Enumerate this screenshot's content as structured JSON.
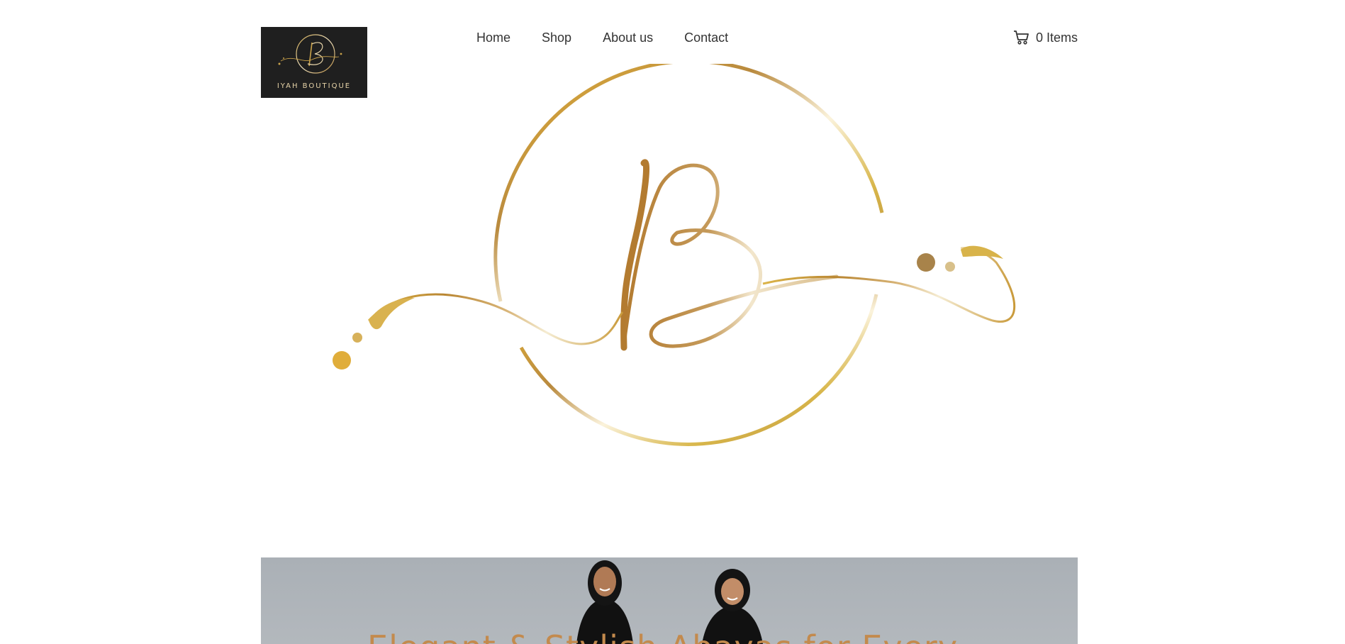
{
  "header": {
    "logo": {
      "brand_text": "IYAH BOUTIQUE",
      "background": "#1f1f1f",
      "icon": "iyah-monogram-logo"
    },
    "nav": [
      {
        "label": "Home"
      },
      {
        "label": "Shop"
      },
      {
        "label": "About us"
      },
      {
        "label": "Contact"
      }
    ],
    "cart": {
      "icon": "cart-icon",
      "label": "0 Items"
    }
  },
  "hero": {
    "emblem": "gold-b-monogram-emblem",
    "accent_color": "#d4a534"
  },
  "banner": {
    "heading": "Elegant & Stylish Abayas for Every",
    "heading_color": "#c38a4d",
    "background": "#aab0b6"
  }
}
